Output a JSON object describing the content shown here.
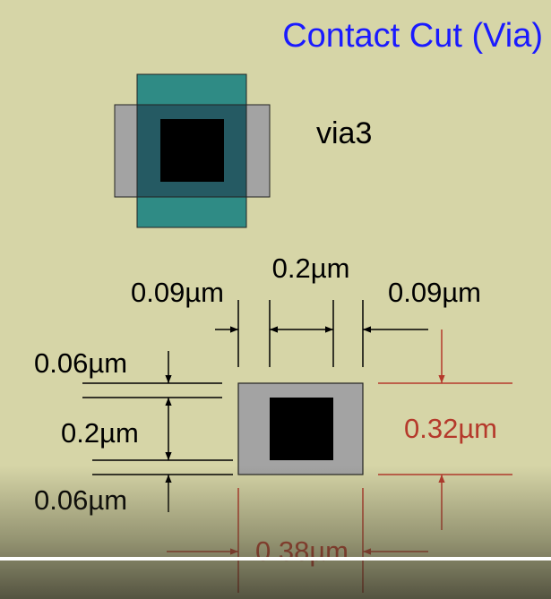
{
  "slide": {
    "title": "Contact Cut (Via)",
    "layer_name": "via3",
    "dimensions": {
      "left_spacing": "0.09µm",
      "via_width": "0.2µm",
      "right_spacing": "0.09µm",
      "top_spacing": "0.06µm",
      "via_height": "0.2µm",
      "bottom_spacing": "0.06µm",
      "pad_height": "0.32µm",
      "pad_width": "0.38µm"
    }
  },
  "colors": {
    "background": "#d6d5a7",
    "title": "#1a1aff",
    "metal_gray": "#a3a3a3",
    "metal_teal": "#2f8b85",
    "overlap": "#255a63",
    "via": "#000000",
    "dimension_black": "#000000",
    "dimension_red": "#b5392b"
  }
}
